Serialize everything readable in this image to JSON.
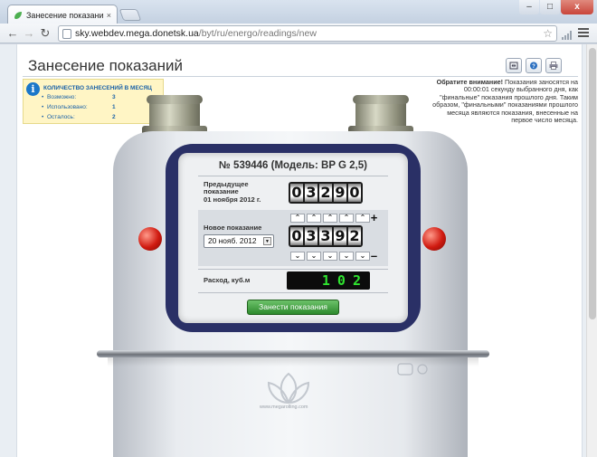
{
  "browser": {
    "tab_title": "Занесение показаний < …",
    "tab_close": "×",
    "win_min": "–",
    "win_max": "□",
    "win_close": "x",
    "nav_back": "←",
    "nav_forward": "→",
    "nav_reload": "↻",
    "url_host": "sky.webdev.mega.donetsk.ua",
    "url_path": "/byt/ru/energo/readings/new",
    "star": "☆"
  },
  "page": {
    "title": "Занесение показаний"
  },
  "infobox": {
    "heading": "КОЛИЧЕСТВО ЗАНЕСЕНИЙ В МЕСЯЦ",
    "rows": [
      {
        "label": "Возможно:",
        "value": "3"
      },
      {
        "label": "Использовано:",
        "value": "1"
      },
      {
        "label": "Осталось:",
        "value": "2"
      }
    ]
  },
  "notice": {
    "bold": "Обратите внимание!",
    "text": " Показания заносятся на 00:00:01 секунду выбранного дня, как \"финальные\" показания прошлого дня. Таким образом, \"финальными\" показаниями прошлого месяца являются показания, внесенные на первое число месяца."
  },
  "meter": {
    "title": "№ 539446 (Модель: BP G 2,5)",
    "previous_label": "Предыдущее показание",
    "previous_date": "01 ноября 2012 г.",
    "previous_digits": [
      "0",
      "3",
      "2",
      "9",
      "0"
    ],
    "new_label": "Новое показание",
    "date_value": "20 нояб. 2012",
    "new_digits": [
      "0",
      "3",
      "3",
      "9",
      "2"
    ],
    "up_arrow": "⌃",
    "down_arrow": "⌄",
    "plus": "+",
    "minus": "–",
    "consumption_label": "Расход, куб.м",
    "consumption_value": "102",
    "submit_label": "Занести показания",
    "brand_text": "www.megarolling.com"
  },
  "colors": {
    "accent_blue": "#1b62a8",
    "frame_navy": "#2a3066",
    "button_green": "#2e8a2e",
    "lcd_green": "#2fe32f",
    "knob_red": "#d01a10"
  }
}
